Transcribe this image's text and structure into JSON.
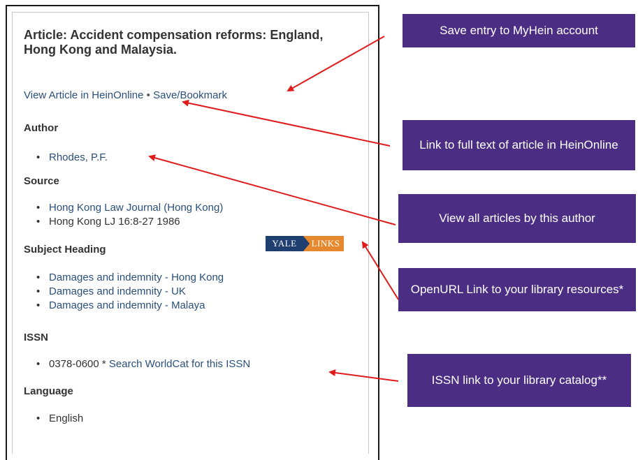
{
  "record": {
    "title_prefix": "Article:",
    "title": "Accident compensation reforms: England, Hong Kong and Malaysia.",
    "view_link": "View Article in HeinOnline",
    "separator": "•",
    "save_link": "Save/Bookmark"
  },
  "sections": {
    "author": {
      "heading": "Author",
      "items": [
        "Rhodes, P.F."
      ]
    },
    "source": {
      "heading": "Source",
      "items": [
        "Hong Kong Law Journal (Hong Kong)",
        "Hong Kong LJ 16:8-27 1986"
      ]
    },
    "subject": {
      "heading": "Subject Heading",
      "items": [
        "Damages and indemnity - Hong Kong",
        "Damages and indemnity - UK",
        "Damages and indemnity - Malaya"
      ]
    },
    "issn": {
      "heading": "ISSN",
      "value": "0378-0600",
      "mid": " * ",
      "search": "Search WorldCat for this ISSN"
    },
    "language": {
      "heading": "Language",
      "items": [
        "English"
      ]
    }
  },
  "yale_links": {
    "part1": "YALE",
    "part2": "LINKS"
  },
  "callouts": {
    "save": "Save entry to MyHein account",
    "fulltext": "Link to full text of article in HeinOnline",
    "author": "View all articles by this author",
    "openurl": "OpenURL Link to your library resources*",
    "issn": "ISSN link to your library catalog**"
  },
  "colors": {
    "callout_bg": "#4b2e83",
    "arrow": "#e01b1b",
    "link": "#2a4f7a"
  }
}
